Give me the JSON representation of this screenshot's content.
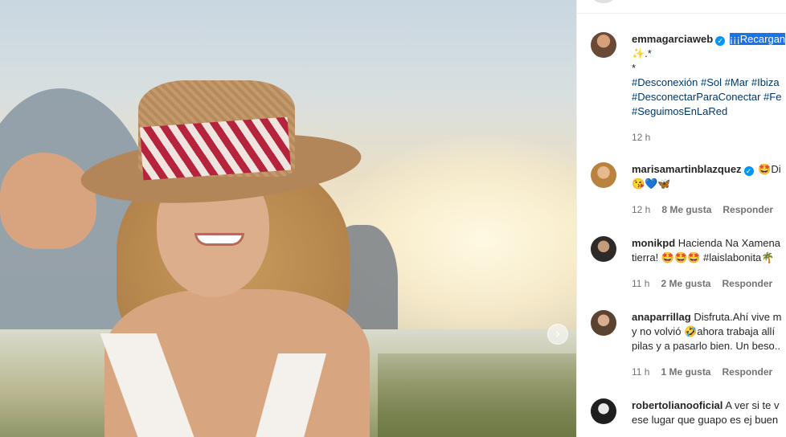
{
  "post": {
    "next_icon": "chevron-right-icon"
  },
  "caption": {
    "username": "emmagarciaweb",
    "text_highlight": "¡¡¡Recargan",
    "line2": "✨.*",
    "line3": "*",
    "hashtags_line1": "#Desconexión #Sol #Mar #Ibiza",
    "hashtags_line2": "#DesconectarParaConectar #Fe",
    "hashtags_line3": "#SeguimosEnLaRed",
    "time": "12 h"
  },
  "comments": [
    {
      "username": "marisamartinblazquez",
      "verified": true,
      "line1": "🤩Di",
      "line2": "😘💙🦋",
      "time": "12 h",
      "likes": "8 Me gusta",
      "reply": "Responder"
    },
    {
      "username": "monikpd",
      "verified": false,
      "line1": "Hacienda Na Xamena",
      "line2": "tierra! 🤩🤩🤩 #laislabonita🌴",
      "time": "11 h",
      "likes": "2 Me gusta",
      "reply": "Responder"
    },
    {
      "username": "anaparrillag",
      "verified": false,
      "line1": "Disfruta.Ahí vive m",
      "line2": "y no volvió 🤣ahora trabaja allí",
      "line3": "pilas y a pasarlo bien. Un beso..",
      "time": "11 h",
      "likes": "1 Me gusta",
      "reply": "Responder"
    },
    {
      "username": "robertolianooficial",
      "verified": false,
      "line1": "A ver si te v",
      "line2": "ese lugar que guapo es ej buen"
    }
  ],
  "colors": {
    "verified": "#0095f6",
    "hashtag": "#00376b",
    "muted": "#737373",
    "selection": "#1a73e8"
  }
}
